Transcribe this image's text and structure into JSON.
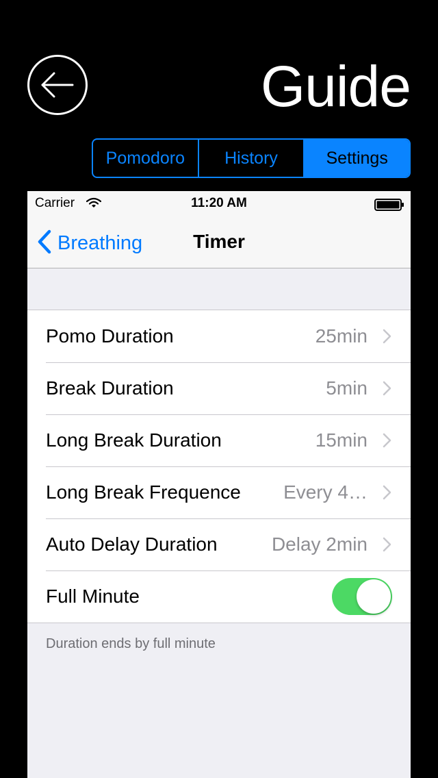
{
  "guide": {
    "title": "Guide",
    "back_icon": "arrow-left-circle-icon",
    "segments": [
      {
        "label": "Pomodoro",
        "selected": false
      },
      {
        "label": "History",
        "selected": false
      },
      {
        "label": "Settings",
        "selected": true
      }
    ],
    "accent_color": "#0a84ff"
  },
  "status_bar": {
    "carrier": "Carrier",
    "time": "11:20 AM"
  },
  "nav_bar": {
    "back_label": "Breathing",
    "title": "Timer",
    "tint_color": "#007aff"
  },
  "settings": {
    "rows": [
      {
        "label": "Pomo Duration",
        "value": "25min"
      },
      {
        "label": "Break Duration",
        "value": "5min"
      },
      {
        "label": "Long Break Duration",
        "value": "15min"
      },
      {
        "label": "Long Break Frequence",
        "value": "Every 4…"
      },
      {
        "label": "Auto Delay Duration",
        "value": "Delay 2min"
      }
    ],
    "toggle_row": {
      "label": "Full Minute",
      "on": true,
      "on_color": "#4cd964"
    },
    "footer": "Duration ends by full minute"
  }
}
